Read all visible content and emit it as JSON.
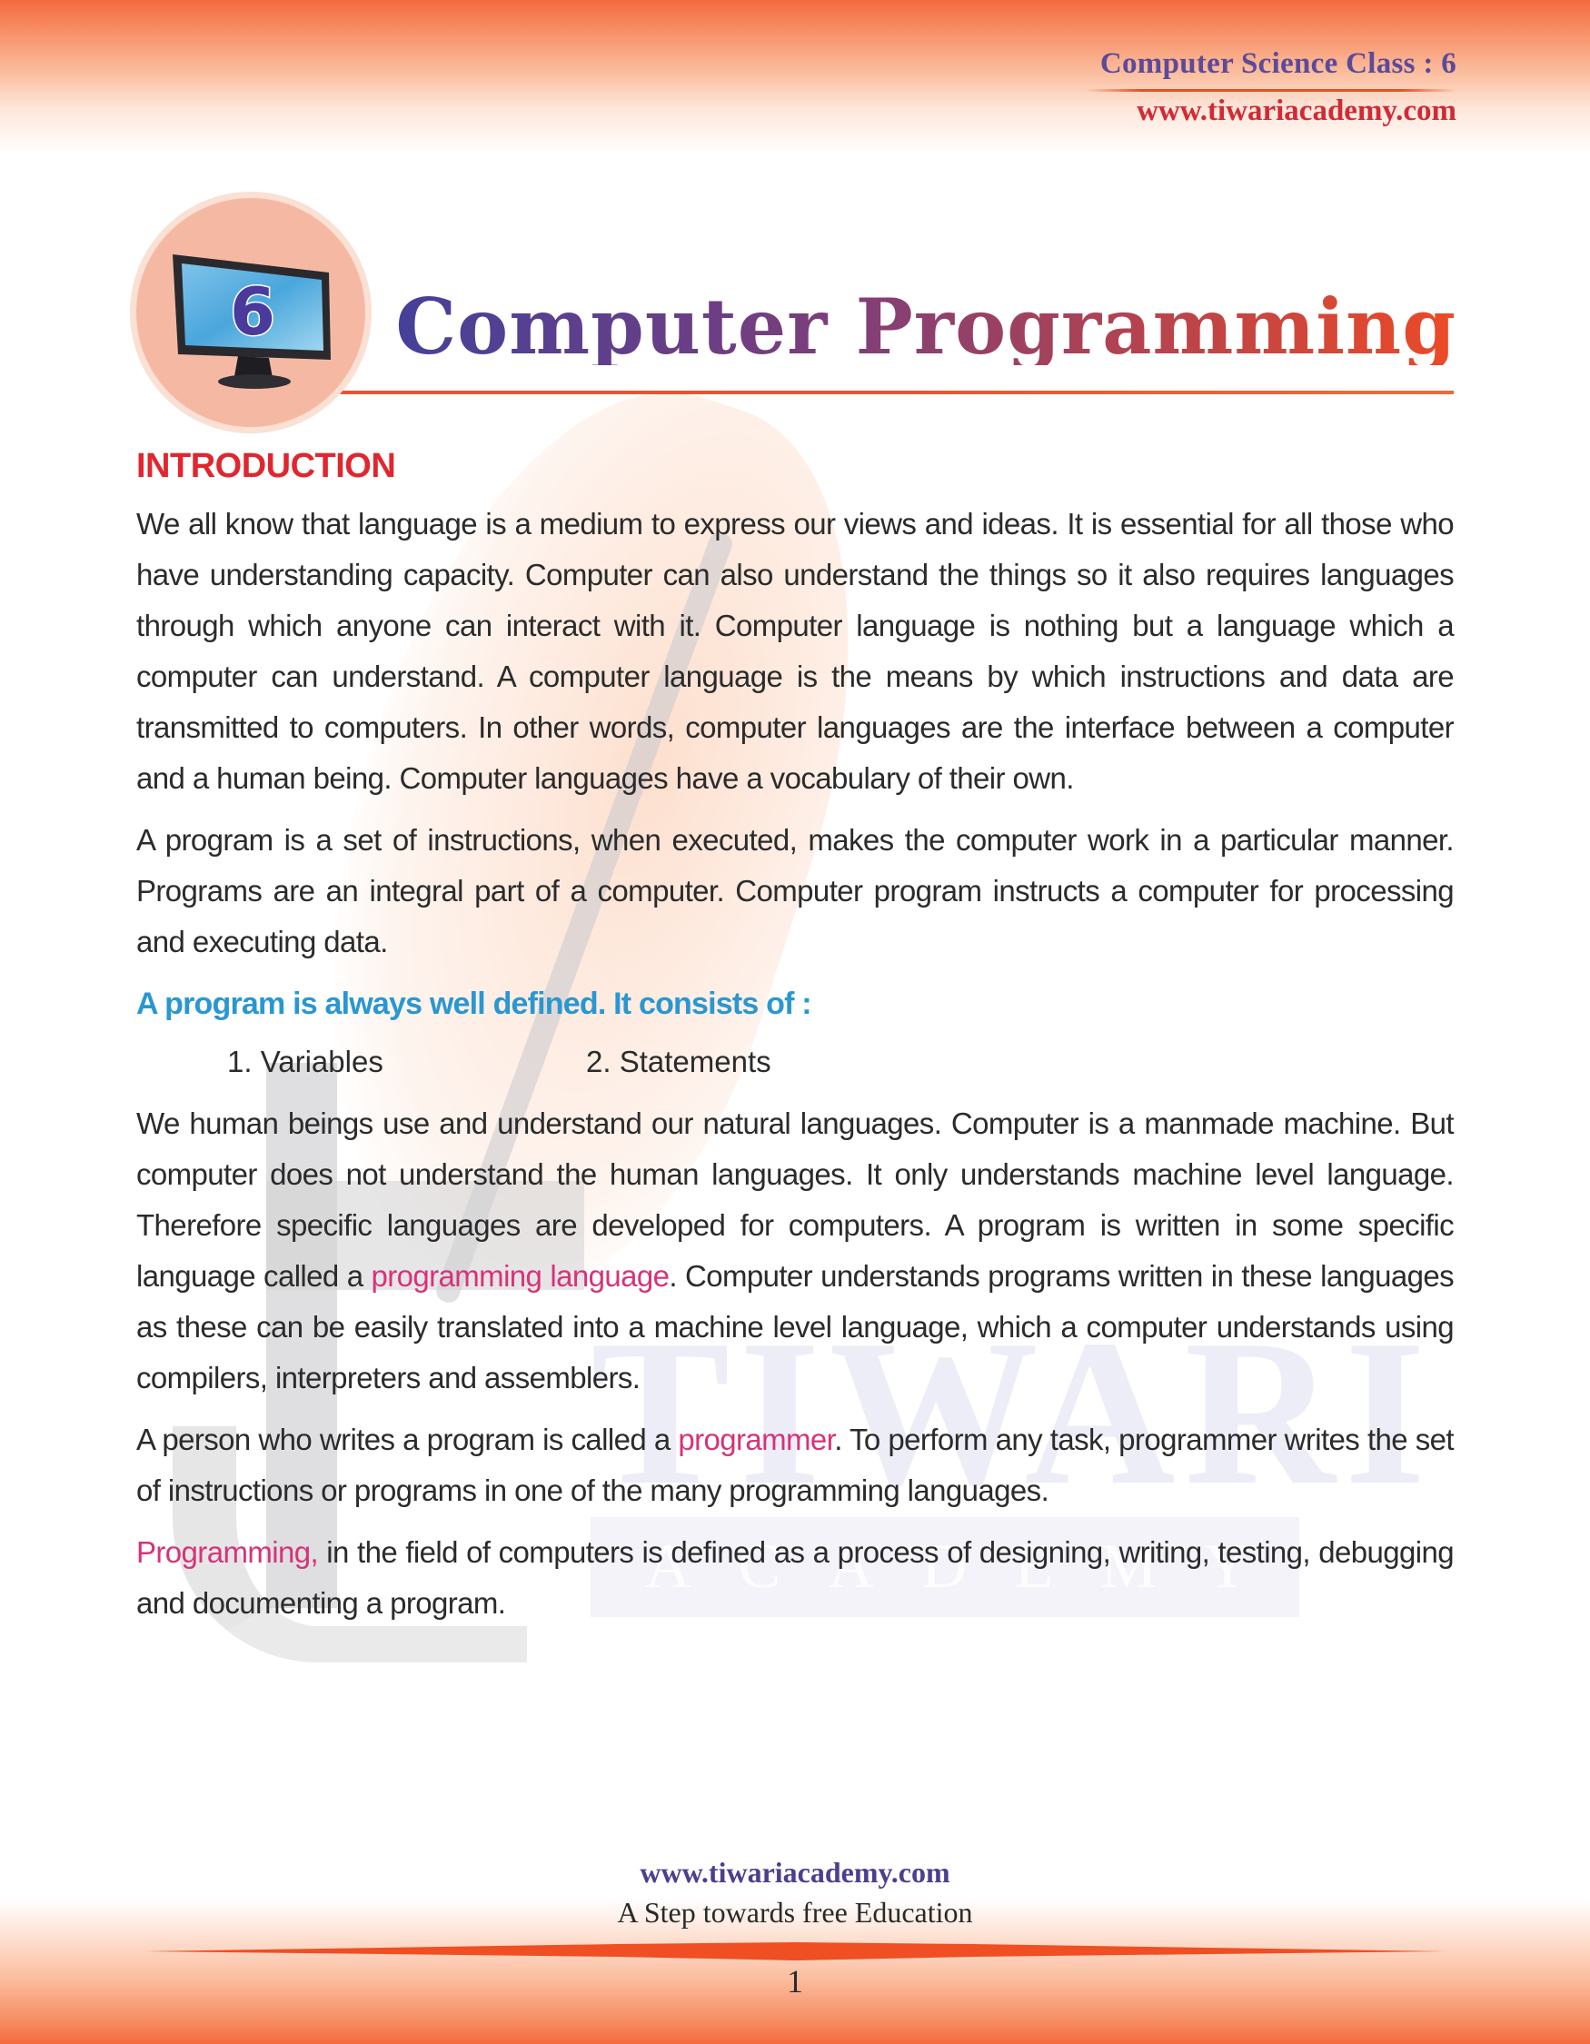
{
  "header": {
    "subject_class": "Computer Science Class : 6",
    "website": "www.tiwariacademy.com"
  },
  "chapter": {
    "number": "6",
    "title": "Computer Programming"
  },
  "watermark": {
    "word": "TIWARI",
    "sub": "ACADEMY"
  },
  "content": {
    "heading": "INTRODUCTION",
    "para1": "We all know that language is a medium to express our views and ideas. It is essential for all those who have understanding capacity. Computer can also understand the things so it also requires languages through which anyone can interact with it. Computer language is nothing but a language which a computer can understand. A computer language is the means by which instructions and data are transmitted to computers. In other words, computer languages are the interface between a computer and a human being. Computer languages have a vocabulary of their own.",
    "para2": "A program is a set of instructions, when executed, makes the computer work in a particular manner.  Programs are an integral part of a computer. Computer program instructs a computer for processing and executing data.",
    "subheading": "A program is always well defined. It consists of :",
    "list": [
      "1.  Variables",
      "2.  Statements"
    ],
    "para3_before": "We human beings use and understand our natural languages. Computer is a manmade machine. But computer does not understand the human languages. It only understands machine level language. Therefore specific languages are developed for computers. A program is written in some specific language called a ",
    "para3_highlight": "programming language",
    "para3_after": ". Computer understands programs written in these languages as these can be easily translated into a machine level language, which a computer understands using compilers, interpreters and assemblers.",
    "para4_before": "A person who writes a program is called a ",
    "para4_highlight": "programmer",
    "para4_after": ". To perform any task, programmer writes the set of instructions or programs in one of the many programming languages.",
    "para5_highlight": "Programming,",
    "para5_after": " in the field of computers is defined as a process of designing, writing, testing, debugging and documenting a program."
  },
  "footer": {
    "website": "www.tiwariacademy.com",
    "tagline": "A Step towards free Education",
    "page_number": "1"
  },
  "colors": {
    "accent_orange": "#f46a3e",
    "heading_red": "#e0262e",
    "subheading_blue": "#2a97d0",
    "highlight_pink": "#d6337a",
    "header_purple": "#5b4a9a"
  }
}
